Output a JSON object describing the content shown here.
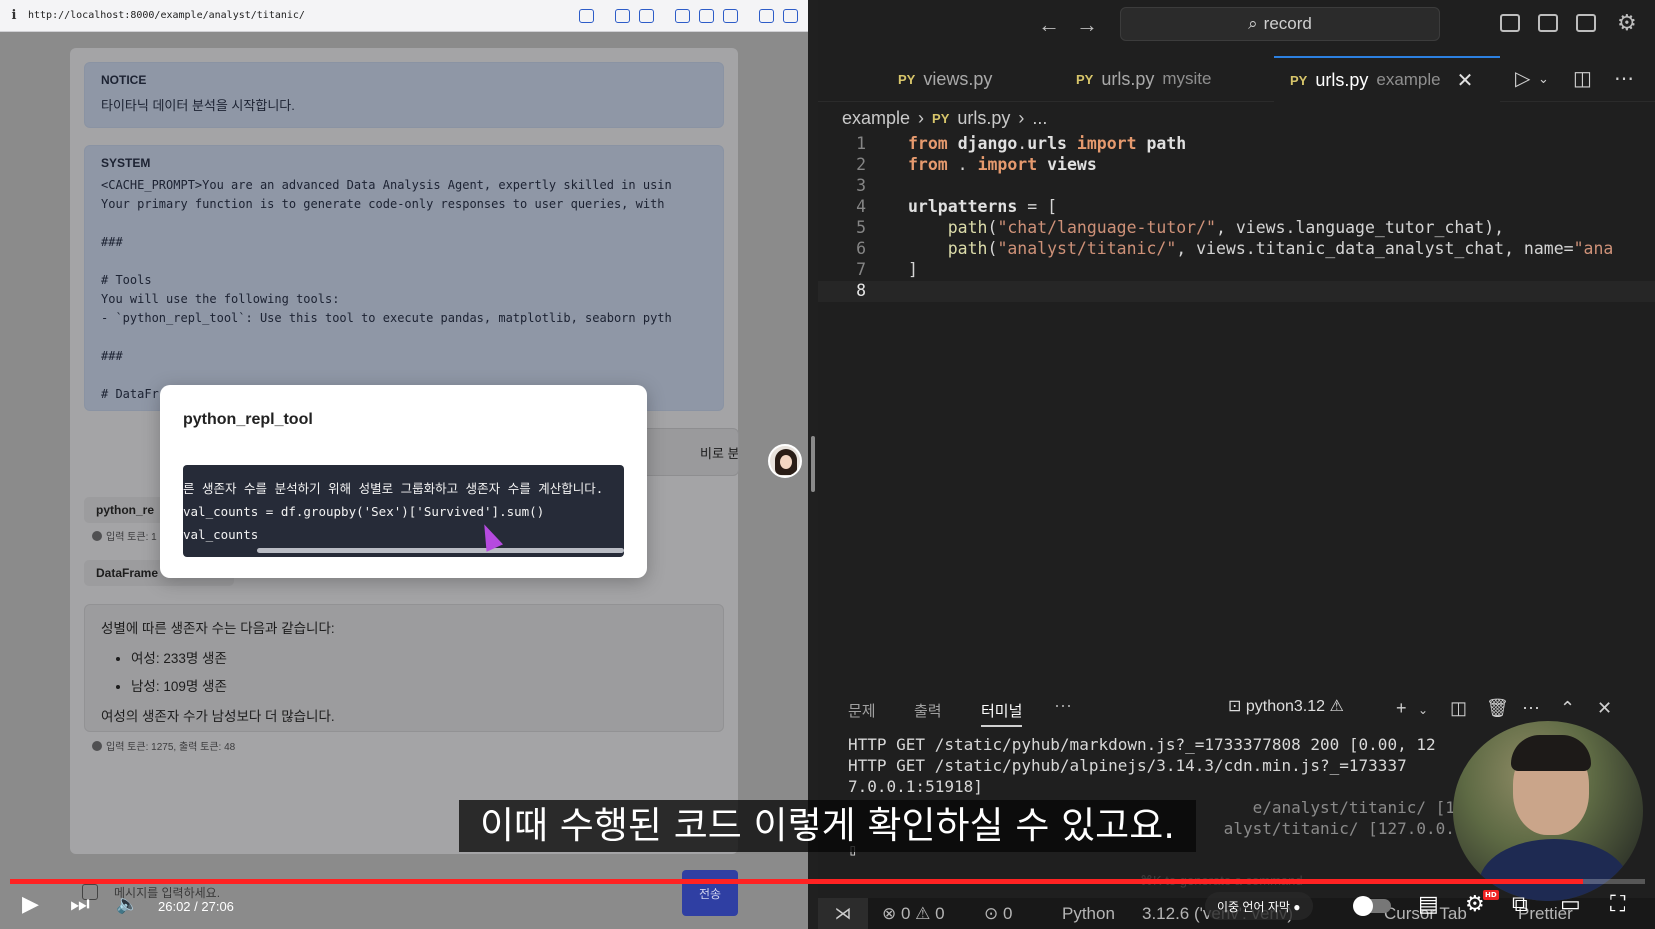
{
  "browser": {
    "url": "http://localhost:8000/example/analyst/titanic/",
    "notice": {
      "title": "NOTICE",
      "text": "타이타닉 데이터 분석을 시작합니다."
    },
    "system": {
      "title": "SYSTEM",
      "lines": [
        "<CACHE_PROMPT>You are an advanced Data Analysis Agent, expertly skilled in usin",
        "Your primary function is to generate code-only responses to user queries, with",
        "",
        "###",
        "",
        "# Tools",
        "You will use the following tools:",
        "- `python_repl_tool`: Use this tool to execute pandas, matplotlib, seaborn pyth",
        "",
        "###",
        "",
        "# DataFr"
      ]
    },
    "user_message": "비로 분석",
    "tool_chip_1": "python_re",
    "tool_meta_1": "입력 토큰: 1",
    "tool_chip_2": "DataFrame",
    "answer": {
      "intro": "성별에 따른 생존자 수는 다음과 같습니다:",
      "items": [
        "여성: 233명 생존",
        "남성: 109명 생존"
      ],
      "conclusion": "여성의 생존자 수가 남성보다 더 많습니다."
    },
    "answer_meta": "입력 토큰: 1275, 출력 토큰: 48",
    "composer": {
      "placeholder": "메시지를 입력하세요.",
      "send_label": "전송"
    },
    "modal": {
      "title": "python_repl_tool",
      "code_lines": [
        "른 생존자 수를 분석하기 위해 성별로 그룹화하고 생존자 수를 계산합니다.",
        "val_counts = df.groupby('Sex')['Survived'].sum()",
        "val_counts"
      ]
    }
  },
  "vscode": {
    "search": "record",
    "tabs": [
      {
        "lang": "PY",
        "name": "views.py",
        "desc": ""
      },
      {
        "lang": "PY",
        "name": "urls.py",
        "desc": "mysite"
      },
      {
        "lang": "PY",
        "name": "urls.py",
        "desc": "example"
      }
    ],
    "breadcrumb": {
      "folder": "example",
      "lang": "PY",
      "file": "urls.py",
      "tail": "..."
    },
    "line_numbers": [
      "1",
      "2",
      "3",
      "4",
      "5",
      "6",
      "7",
      "8"
    ],
    "panel_tabs": [
      "문제",
      "출력",
      "터미널"
    ],
    "python_label": "python3.12",
    "terminal_lines": [
      "HTTP GET /static/pyhub/markdown.js?_=1733377808 200 [0.00, 12",
      "HTTP GET /static/pyhub/alpinejs/3.14.3/cdn.min.js?_=173337",
      "7.0.0.1:51918]",
      "                                          e/analyst/titanic/ [127.0.",
      "                                       alyst/titanic/ [127.0.0.1:",
      "▯"
    ],
    "cmd_hint": "⌘K to generate a command",
    "status": {
      "errors": "0",
      "warnings": "0",
      "ports": "0",
      "language": "Python",
      "env": "3.12.6 ('venv': venv)",
      "cursor_tab": "Cursor Tab",
      "prettier": "Prettier"
    }
  },
  "player": {
    "subtitle": "이때 수행된 코드 이렇게 확인하실 수 있고요.",
    "time": "26:02 / 27:06",
    "dual_sub_label": "이중 언어 자막",
    "progress": 0.962,
    "accent": "#ff2222"
  }
}
